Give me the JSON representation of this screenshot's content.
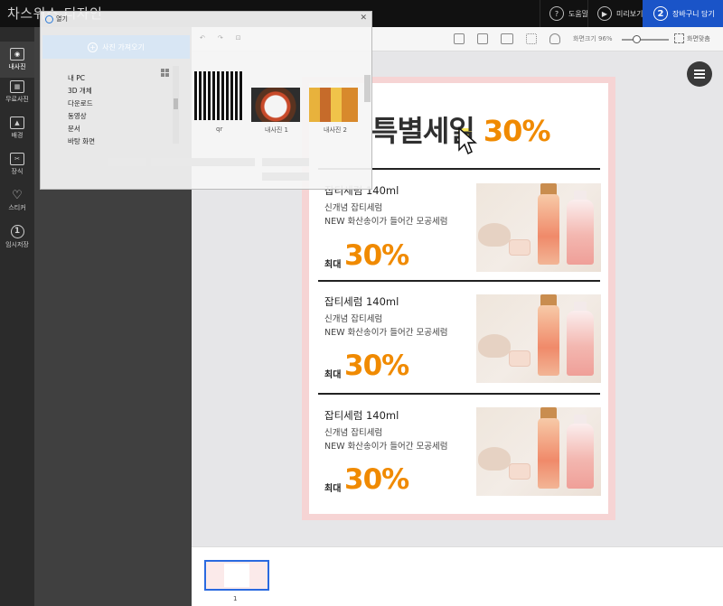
{
  "app": {
    "title": "차스위스 디자인"
  },
  "topbar": {
    "help_label": "도움말",
    "preview_label": "미리보기",
    "cart_label": "장바구니 담기",
    "cart_step": "2"
  },
  "sidebar": {
    "items": [
      {
        "label": "내사진",
        "icon": "photo-icon"
      },
      {
        "label": "무료사진",
        "icon": "free-photo-icon"
      },
      {
        "label": "배경",
        "icon": "image-icon"
      },
      {
        "label": "장식",
        "icon": "decoration-icon"
      },
      {
        "label": "스티커",
        "icon": "heart-icon"
      },
      {
        "label": "임시저장",
        "icon": "number-one-icon"
      }
    ]
  },
  "toolbar": {
    "zoom_label": "화면크기 96%",
    "zoom_value": 96,
    "fit_label": "화면맞춤"
  },
  "design": {
    "headline_prefix": "특별세일",
    "headline_percent": "30%",
    "products": [
      {
        "title": "잡티세럼 140ml",
        "line1": "신개념 잡티세럼",
        "line2": "NEW 화산송이가 들어간 모공세럼",
        "max_label": "최대",
        "percent": "30%"
      },
      {
        "title": "잡티세럼 140ml",
        "line1": "신개념 잡티세럼",
        "line2": "NEW 화산송이가 들어간 모공세럼",
        "max_label": "최대",
        "percent": "30%"
      },
      {
        "title": "잡티세럼 140ml",
        "line1": "신개념 잡티세럼",
        "line2": "NEW 화산송이가 들어간 모공세럼",
        "max_label": "최대",
        "percent": "30%"
      }
    ]
  },
  "pages": {
    "current": "1"
  },
  "dialog": {
    "title": "열기",
    "upload_label": "사진 가져오기",
    "folders": [
      "내 PC",
      "3D 개체",
      "다운로드",
      "동영상",
      "문서",
      "바탕 화면"
    ],
    "images": [
      {
        "caption": "qr"
      },
      {
        "caption": "내사진 1"
      },
      {
        "caption": "내사진 2"
      }
    ]
  }
}
